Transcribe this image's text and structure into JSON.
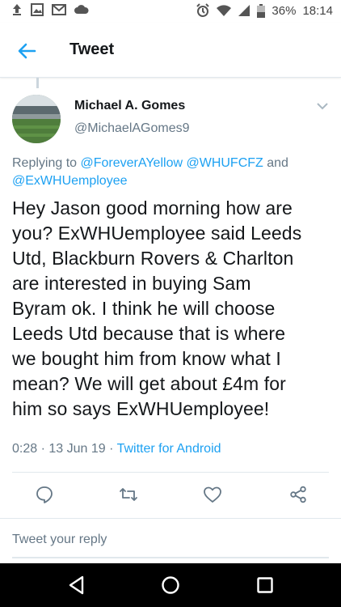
{
  "status_bar": {
    "battery": "36%",
    "time": "18:14"
  },
  "app_bar": {
    "title": "Tweet",
    "back_icon": "arrow-left-icon"
  },
  "tweet": {
    "author_name": "Michael A. Gomes",
    "author_handle": "@MichaelAGomes9",
    "replying_prefix": "Replying to ",
    "mentions": [
      "@ForeverAYellow",
      "@WHUFCFZ",
      "@ExWHUemployee"
    ],
    "replying_and": " and ",
    "text": "Hey Jason good morning how are\nyou? ExWHUemployee said Leeds\nUtd, Blackburn Rovers  & Charlton\nare interested in buying Sam\nByram ok. I think he will choose\nLeeds Utd because that is where\nwe bought him from know what I\nmean? We will get about £4m for\nhim so says ExWHUemployee!",
    "time": "0:28",
    "date": "13 Jun 19",
    "separator": " · ",
    "source": "Twitter for Android"
  },
  "actions": {
    "reply_icon": "reply-icon",
    "retweet_icon": "retweet-icon",
    "like_icon": "heart-icon",
    "share_icon": "share-icon"
  },
  "reply_box": {
    "placeholder": "Tweet your reply"
  },
  "colors": {
    "accent": "#1da1f2",
    "secondary_text": "#657786",
    "primary_text": "#14171a",
    "divider": "#e1e8ed"
  }
}
